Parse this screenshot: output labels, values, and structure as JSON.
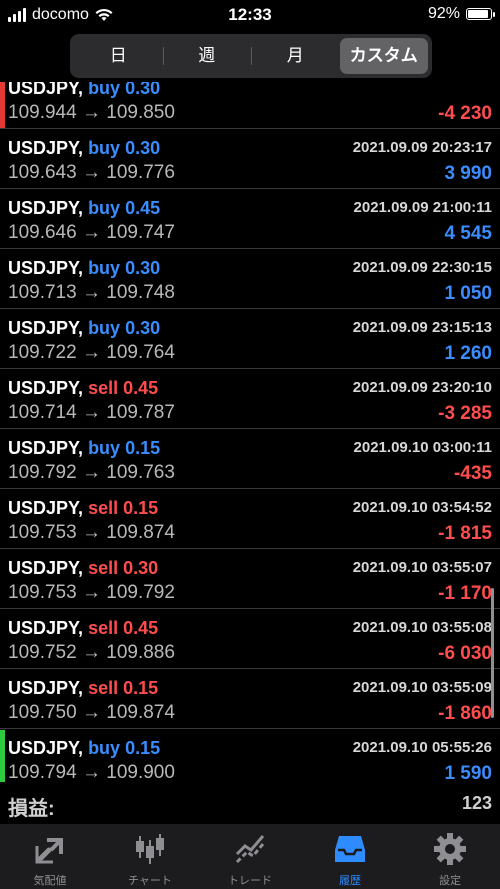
{
  "status": {
    "carrier": "docomo",
    "time": "12:33",
    "battery": "92%"
  },
  "segments": [
    {
      "label": "日",
      "active": false
    },
    {
      "label": "週",
      "active": false
    },
    {
      "label": "月",
      "active": false
    },
    {
      "label": "カスタム",
      "active": true
    }
  ],
  "trades": [
    {
      "symbol": "USDJPY,",
      "side": "buy",
      "lot": "0.30",
      "time": "",
      "from": "109.944",
      "to": "109.850",
      "pl": "-4 230",
      "pl_sign": "neg"
    },
    {
      "symbol": "USDJPY,",
      "side": "buy",
      "lot": "0.30",
      "time": "2021.09.09 20:23:17",
      "from": "109.643",
      "to": "109.776",
      "pl": "3 990",
      "pl_sign": "pos"
    },
    {
      "symbol": "USDJPY,",
      "side": "buy",
      "lot": "0.45",
      "time": "2021.09.09 21:00:11",
      "from": "109.646",
      "to": "109.747",
      "pl": "4 545",
      "pl_sign": "pos"
    },
    {
      "symbol": "USDJPY,",
      "side": "buy",
      "lot": "0.30",
      "time": "2021.09.09 22:30:15",
      "from": "109.713",
      "to": "109.748",
      "pl": "1 050",
      "pl_sign": "pos"
    },
    {
      "symbol": "USDJPY,",
      "side": "buy",
      "lot": "0.30",
      "time": "2021.09.09 23:15:13",
      "from": "109.722",
      "to": "109.764",
      "pl": "1 260",
      "pl_sign": "pos"
    },
    {
      "symbol": "USDJPY,",
      "side": "sell",
      "lot": "0.45",
      "time": "2021.09.09 23:20:10",
      "from": "109.714",
      "to": "109.787",
      "pl": "-3 285",
      "pl_sign": "neg"
    },
    {
      "symbol": "USDJPY,",
      "side": "buy",
      "lot": "0.15",
      "time": "2021.09.10 03:00:11",
      "from": "109.792",
      "to": "109.763",
      "pl": "-435",
      "pl_sign": "neg"
    },
    {
      "symbol": "USDJPY,",
      "side": "sell",
      "lot": "0.15",
      "time": "2021.09.10 03:54:52",
      "from": "109.753",
      "to": "109.874",
      "pl": "-1 815",
      "pl_sign": "neg"
    },
    {
      "symbol": "USDJPY,",
      "side": "sell",
      "lot": "0.30",
      "time": "2021.09.10 03:55:07",
      "from": "109.753",
      "to": "109.792",
      "pl": "-1 170",
      "pl_sign": "neg"
    },
    {
      "symbol": "USDJPY,",
      "side": "sell",
      "lot": "0.45",
      "time": "2021.09.10 03:55:08",
      "from": "109.752",
      "to": "109.886",
      "pl": "-6 030",
      "pl_sign": "neg"
    },
    {
      "symbol": "USDJPY,",
      "side": "sell",
      "lot": "0.15",
      "time": "2021.09.10 03:55:09",
      "from": "109.750",
      "to": "109.874",
      "pl": "-1 860",
      "pl_sign": "neg"
    },
    {
      "symbol": "USDJPY,",
      "side": "buy",
      "lot": "0.15",
      "time": "2021.09.10 05:55:26",
      "from": "109.794",
      "to": "109.900",
      "pl": "1 590",
      "pl_sign": "pos"
    }
  ],
  "arrow": "→",
  "total": {
    "label": "損益:",
    "value": "123"
  },
  "tabs": [
    {
      "label": "気配値",
      "icon": "quotes-icon",
      "active": false
    },
    {
      "label": "チャート",
      "icon": "candlestick-chart-icon",
      "active": false
    },
    {
      "label": "トレード",
      "icon": "trade-chart-icon",
      "active": false
    },
    {
      "label": "履歴",
      "icon": "history-inbox-icon",
      "active": true
    },
    {
      "label": "設定",
      "icon": "gear-icon",
      "active": false
    }
  ],
  "colors": {
    "buy": "#3a8dff",
    "sell": "#ff4d4d",
    "loss_marker": "#e53935",
    "profit_marker": "#2ecc40",
    "active_tab": "#2f8cff"
  }
}
